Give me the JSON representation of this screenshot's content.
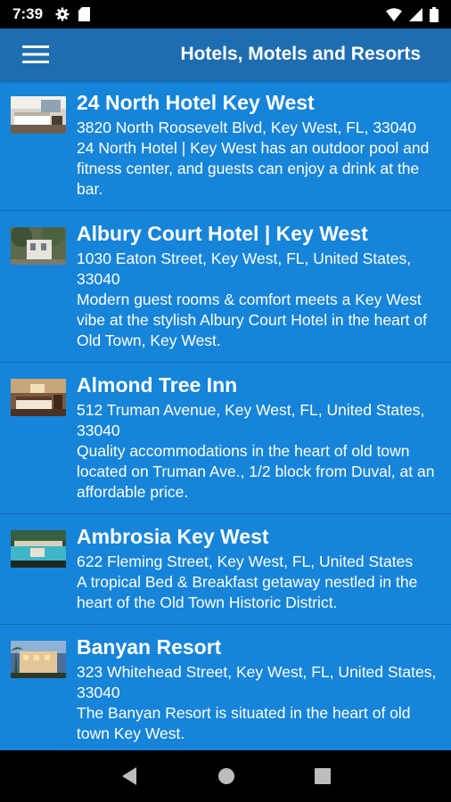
{
  "status_bar": {
    "time": "7:39",
    "icons_left": [
      "gear-icon",
      "sim-card-icon"
    ],
    "icons_right": [
      "wifi-icon",
      "signal-icon",
      "battery-icon"
    ]
  },
  "app_bar": {
    "title": "Hotels, Motels and Resorts",
    "menu_icon": "hamburger-menu-icon"
  },
  "hotels": [
    {
      "name": "24 North Hotel Key West",
      "address": "3820 North Roosevelt Blvd, Key West, FL, 33040",
      "description": "24 North Hotel | Key West has an outdoor pool and fitness center, and guests can enjoy a drink at the bar."
    },
    {
      "name": "Albury Court Hotel | Key West",
      "address": "1030 Eaton Street, Key West, FL, United States, 33040",
      "description": "Modern guest rooms & comfort meets a Key West vibe at the stylish Albury Court Hotel in the heart of Old Town, Key West."
    },
    {
      "name": "Almond Tree Inn",
      "address": "512 Truman Avenue, Key West, FL, United States, 33040",
      "description": "Quality accommodations in the heart of old town located on Truman Ave., 1/2 block from Duval, at an affordable price."
    },
    {
      "name": "Ambrosia Key West",
      "address": "622 Fleming Street, Key West, FL, United States",
      "description": "A tropical Bed & Breakfast getaway nestled in the heart of the Old Town Historic District."
    },
    {
      "name": "Banyan Resort",
      "address": "323 Whitehead Street, Key West, FL, United States, 33040",
      "description": "The Banyan Resort is situated in the heart of old town Key West."
    }
  ],
  "nav_bar": {
    "icons": [
      "back-icon",
      "home-icon",
      "recents-icon"
    ]
  },
  "colors": {
    "app_bar": "#1f6db1",
    "list_background": "#1684d9",
    "divider": "#0f6cb4",
    "text": "#ffffff"
  }
}
